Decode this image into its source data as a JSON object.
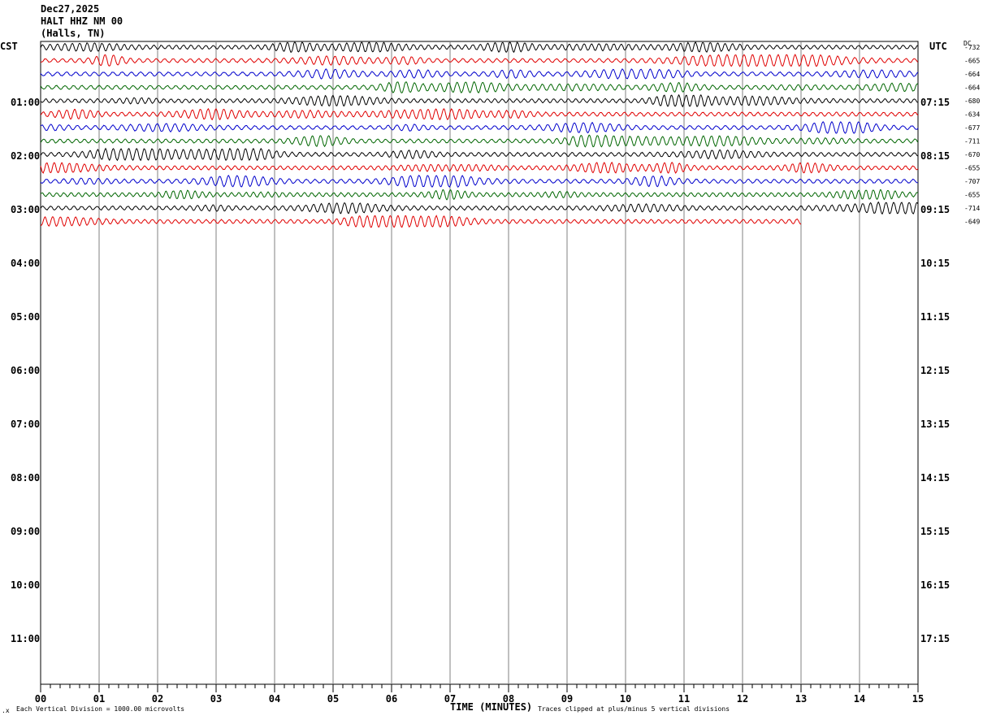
{
  "header": {
    "date": "Dec27,2025",
    "station": "HALT HHZ NM 00",
    "location": "(Halls, TN)"
  },
  "left_tz": "CST",
  "right_tz": "UTC",
  "dc_label": "DC",
  "footer": {
    "scale_note": "Each Vertical Division = 1000.00 microvolts",
    "xlabel": "TIME (MINUTES)",
    "clip_note": "Traces clipped at plus/minus 5 vertical divisions"
  },
  "colors": {
    "trace_cycle": [
      "#000000",
      "#e00000",
      "#0000cc",
      "#006600"
    ],
    "grid": "#808080"
  },
  "chart_data": {
    "type": "line",
    "title": "HALT HHZ NM 00",
    "xlabel": "TIME (MINUTES)",
    "xlim": [
      0,
      15
    ],
    "x_ticks": [
      "00",
      "01",
      "02",
      "03",
      "04",
      "05",
      "06",
      "07",
      "08",
      "09",
      "10",
      "11",
      "12",
      "13",
      "14",
      "15"
    ],
    "left_time_labels": [
      "01:00",
      "02:00",
      "03:00",
      "04:00",
      "05:00",
      "06:00",
      "07:00",
      "08:00",
      "09:00",
      "10:00",
      "11:00"
    ],
    "right_time_labels": [
      "07:15",
      "08:15",
      "09:15",
      "10:15",
      "11:15",
      "12:15",
      "13:15",
      "14:15",
      "15:15",
      "16:15",
      "17:15"
    ],
    "trace_minutes_per_row": 15,
    "traces": [
      {
        "dc": "-732",
        "color": "#000000",
        "end_minute": 15
      },
      {
        "dc": "-665",
        "color": "#e00000",
        "end_minute": 15
      },
      {
        "dc": "-664",
        "color": "#0000cc",
        "end_minute": 15
      },
      {
        "dc": "-664",
        "color": "#006600",
        "end_minute": 15
      },
      {
        "dc": "-680",
        "color": "#000000",
        "end_minute": 15
      },
      {
        "dc": "-634",
        "color": "#e00000",
        "end_minute": 15
      },
      {
        "dc": "-677",
        "color": "#0000cc",
        "end_minute": 15
      },
      {
        "dc": "-711",
        "color": "#006600",
        "end_minute": 15
      },
      {
        "dc": "-670",
        "color": "#000000",
        "end_minute": 15
      },
      {
        "dc": "-655",
        "color": "#e00000",
        "end_minute": 15
      },
      {
        "dc": "-707",
        "color": "#0000cc",
        "end_minute": 15
      },
      {
        "dc": "-655",
        "color": "#006600",
        "end_minute": 15
      },
      {
        "dc": "-714",
        "color": "#000000",
        "end_minute": 15
      },
      {
        "dc": "-649",
        "color": "#e00000",
        "end_minute": 13
      }
    ]
  }
}
